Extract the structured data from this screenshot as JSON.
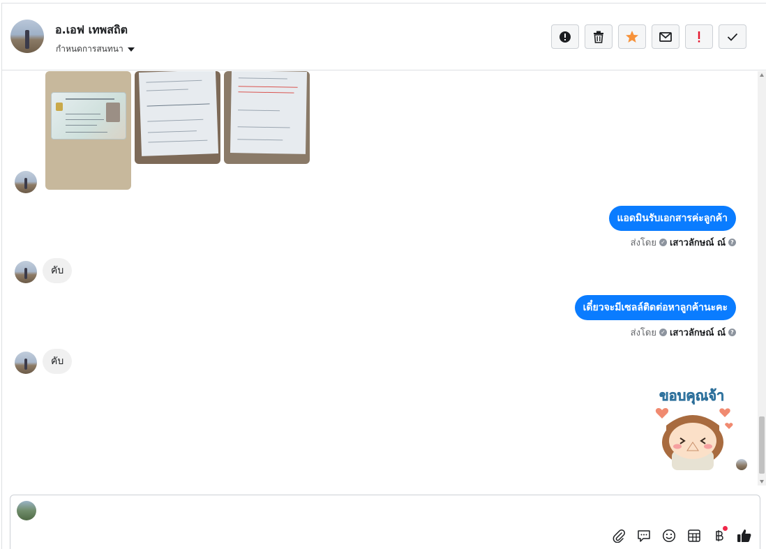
{
  "header": {
    "name": "อ.เอฟ เทพสถิต",
    "subtitle": "กำหนดการสนทนา",
    "actions": [
      {
        "id": "spam",
        "icon": "alert-circle-icon"
      },
      {
        "id": "delete",
        "icon": "trash-icon"
      },
      {
        "id": "star",
        "icon": "star-icon",
        "color": "#f7923a"
      },
      {
        "id": "mail",
        "icon": "envelope-icon"
      },
      {
        "id": "important",
        "icon": "exclamation-icon",
        "color": "#e4152b"
      },
      {
        "id": "done",
        "icon": "check-icon"
      }
    ]
  },
  "messages": [
    {
      "type": "images",
      "from": "customer",
      "count": 3
    },
    {
      "type": "text",
      "from": "page",
      "text": "แอดมินรับเอกสารค่ะลูกค้า",
      "sent_by_label": "ส่งโดย",
      "sender": "เสาวลักษณ์ ณ์"
    },
    {
      "type": "text",
      "from": "customer",
      "text": "คับ"
    },
    {
      "type": "text",
      "from": "page",
      "text": "เดี๋ยวจะมีเซลล์ติดต่อหาลูกค้านะคะ",
      "sent_by_label": "ส่งโดย",
      "sender": "เสาวลักษณ์ ณ์"
    },
    {
      "type": "text",
      "from": "customer",
      "text": "คับ"
    },
    {
      "type": "sticker",
      "from": "page",
      "text": "ขอบคุณจ้า"
    }
  ],
  "composer": {
    "placeholder": "",
    "tools": [
      "paperclip-icon",
      "speech-bubble-icon",
      "smiley-icon",
      "table-icon",
      "baht-icon",
      "thumbs-up-icon"
    ]
  },
  "colors": {
    "outgoing": "#0a7cff",
    "incoming": "#f0f0f0",
    "star": "#f7923a",
    "important": "#e4152b"
  }
}
